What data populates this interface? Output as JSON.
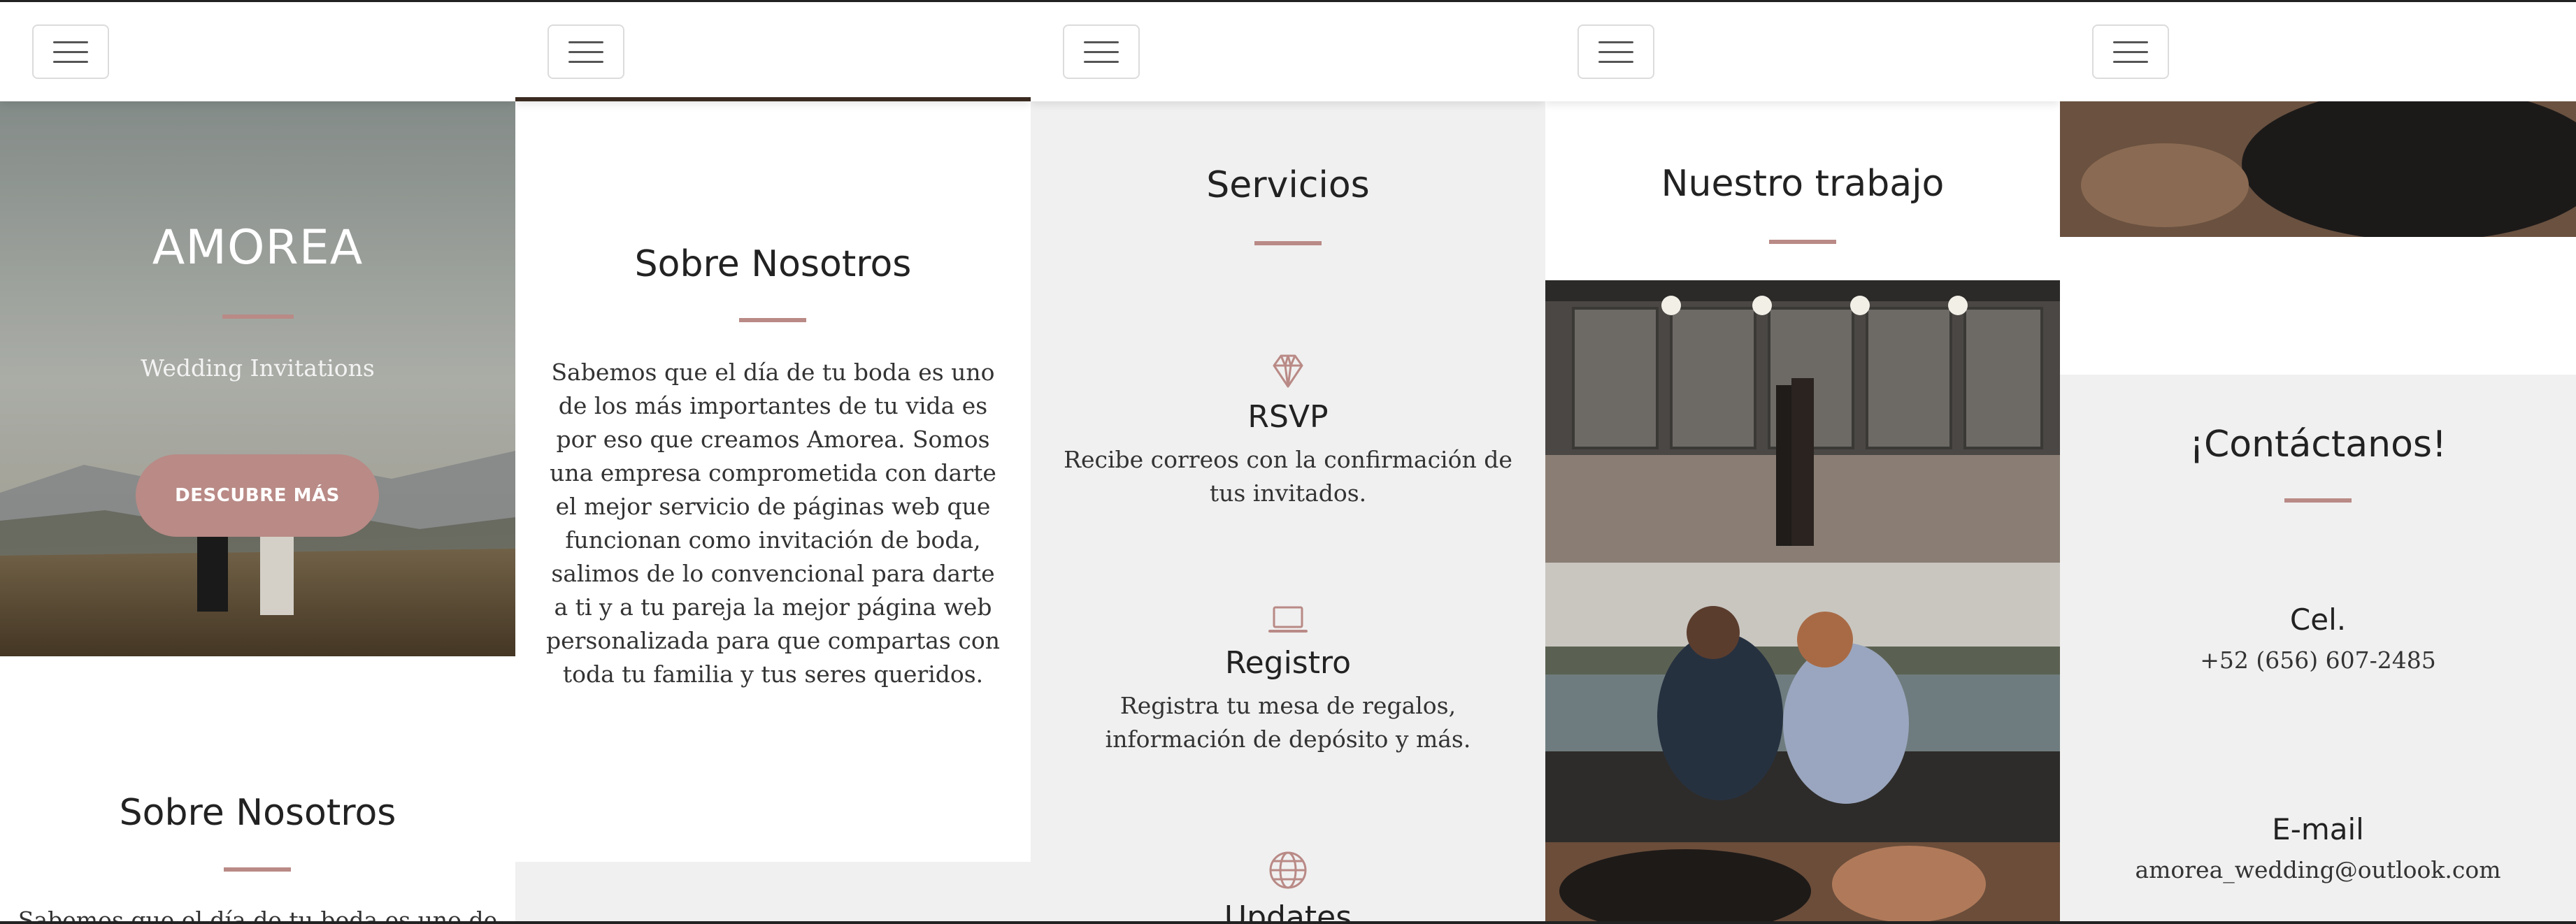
{
  "hero": {
    "title": "AMOREA",
    "subtitle": "Wedding Invitations",
    "cta_label": "DESCUBRE MÁS"
  },
  "about": {
    "title": "Sobre Nosotros",
    "text": "Sabemos que el día de tu boda es uno de los más importantes de tu vida es por eso que creamos Amorea. Somos una empresa comprometida con darte el mejor servicio de páginas web que funcionan como invitación de boda, salimos de lo convencional para darte a ti y a tu pareja la mejor página web personalizada para que compartas con toda tu familia y tus seres queridos.",
    "text_partial": "Sabemos que el día de tu boda es uno de"
  },
  "services": {
    "title": "Servicios",
    "items": [
      {
        "icon": "diamond-icon",
        "title": "RSVP",
        "desc": "Recibe correos con la confirmación de tus invitados."
      },
      {
        "icon": "laptop-icon",
        "title": "Registro",
        "desc": "Registra tu mesa de regalos, información de depósito y más."
      },
      {
        "icon": "globe-icon",
        "title": "Updates",
        "desc": ""
      }
    ]
  },
  "work": {
    "title": "Nuestro trabajo"
  },
  "contact": {
    "title": "¡Contáctanos!",
    "phone_label": "Cel.",
    "phone": "+52 (656) 607-2485",
    "email_label": "E-mail",
    "email": "amorea_wedding@outlook.com"
  },
  "colors": {
    "accent": "#b98a86",
    "section_gray": "#f0f0f0"
  }
}
